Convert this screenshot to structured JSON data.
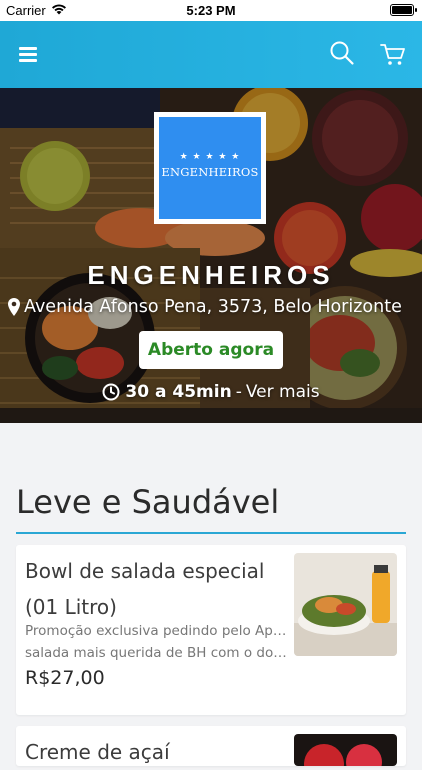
{
  "status_bar": {
    "carrier": "Carrier",
    "time": "5:23 PM"
  },
  "navbar": {
    "menu_icon": "hamburger-menu-icon",
    "search_icon": "search-icon",
    "cart_icon": "cart-icon",
    "color": "#23ade0"
  },
  "hero": {
    "logo": {
      "stars": "★ ★ ★ ★ ★",
      "brand": "ENGENHEIROS",
      "color": "#2f8ef0"
    },
    "store_name": "ENGENHEIROS",
    "address": "Avenida Afonso Pena, 3573, Belo Horizonte",
    "status": "Aberto agora",
    "status_color": "#2b8a26",
    "delivery_time": "30 a 45min",
    "separator": "-",
    "more_link": "Ver mais"
  },
  "section": {
    "title": "Leve e Saudável",
    "accent": "#2aa7d4"
  },
  "products": [
    {
      "title": "Bowl de salada especial (01 Litro)",
      "description_line1": "Promoção exclusiva pedindo pelo App! A",
      "description_line2": "salada mais querida de BH com o dobro de",
      "price": "R$27,00"
    },
    {
      "title": "Creme de açaí",
      "description_line1": "",
      "description_line2": "",
      "price": ""
    }
  ]
}
